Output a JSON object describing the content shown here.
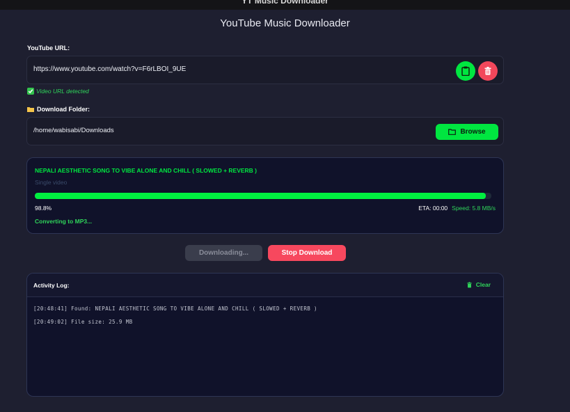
{
  "window": {
    "title": "YT Music Downloader"
  },
  "app": {
    "title": "YouTube Music Downloader"
  },
  "url_section": {
    "label": "YouTube URL:",
    "value": "https://www.youtube.com/watch?v=F6rLBOI_9UE",
    "paste_icon": "clipboard-icon",
    "clear_icon": "trash-icon",
    "status": "Video URL detected",
    "status_icon": "check-box-icon"
  },
  "folder_section": {
    "label": "Download Folder:",
    "label_icon": "folder-icon",
    "value": "/home/wabisabi/Downloads",
    "browse_label": "Browse",
    "browse_icon": "folder-outline-icon"
  },
  "download_card": {
    "title": "NEPALI AESTHETIC SONG TO VIBE ALONE AND CHILL ( SLOWED + REVERB )",
    "subtitle": "Single video",
    "progress_percent": 98.8,
    "progress_text": "98.8%",
    "eta": "ETA: 00:00",
    "speed": "Speed: 5.8 MB/s",
    "status": "Converting to MP3..."
  },
  "actions": {
    "downloading_label": "Downloading...",
    "stop_label": "Stop Download"
  },
  "log": {
    "title": "Activity Log:",
    "clear_label": "Clear",
    "clear_icon": "trash-icon",
    "lines": [
      "[20:48:41] Found: NEPALI AESTHETIC SONG TO VIBE ALONE AND CHILL ( SLOWED + REVERB )",
      "[20:49:02] File size: 25.9 MB"
    ]
  },
  "colors": {
    "accent_green": "#00e640",
    "danger_red": "#f2475b",
    "background": "#1e1f30",
    "card": "#10122a"
  }
}
